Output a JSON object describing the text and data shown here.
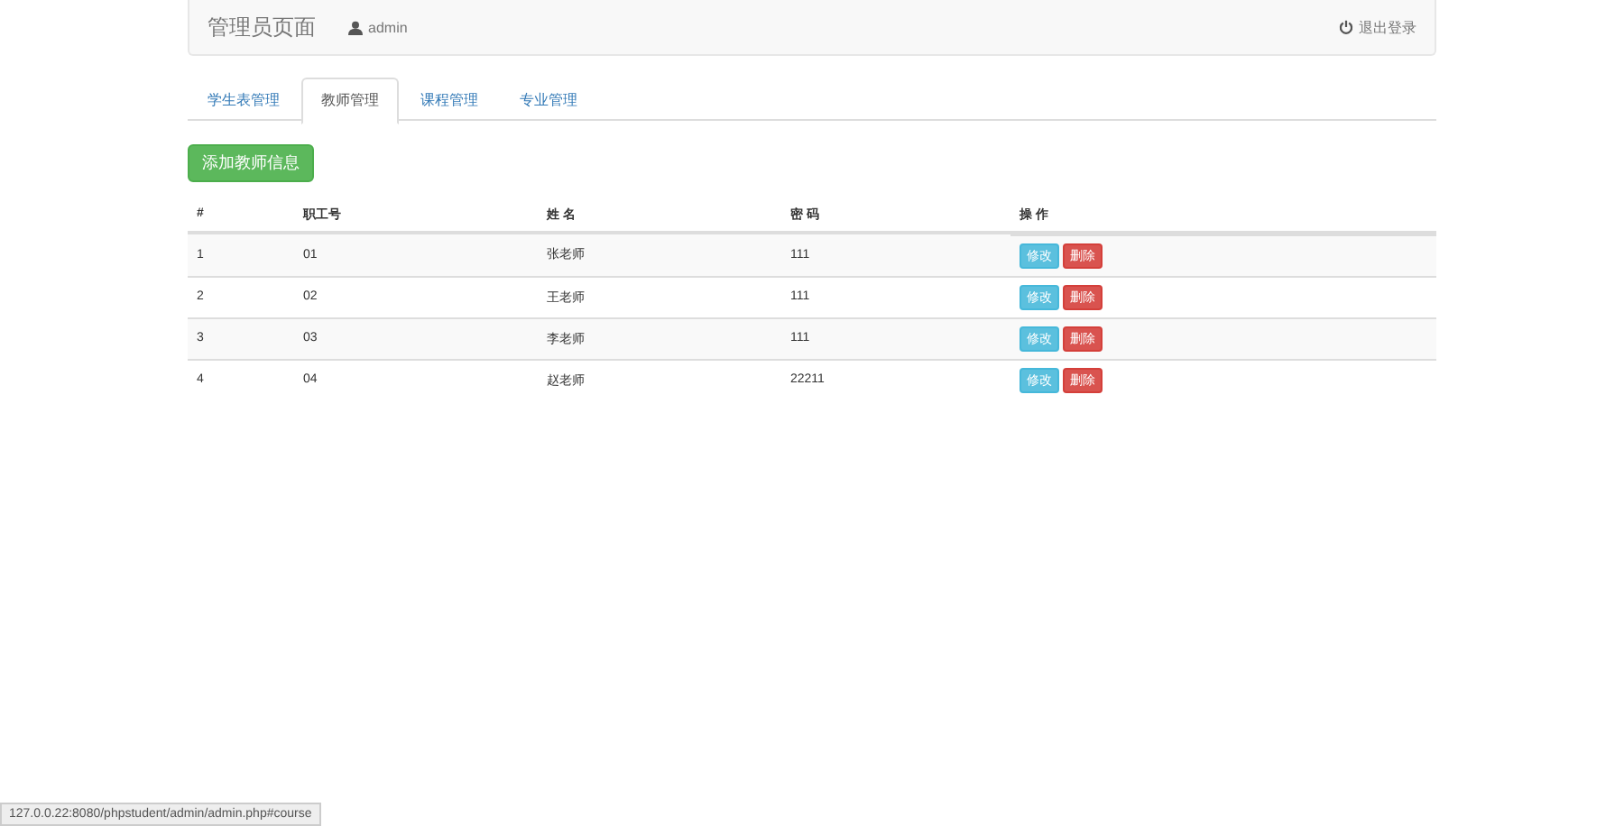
{
  "navbar": {
    "brand": "管理员页面",
    "user": "admin",
    "logout": "退出登录"
  },
  "tabs": [
    {
      "label": "学生表管理",
      "selected": false
    },
    {
      "label": "教师管理",
      "selected": true
    },
    {
      "label": "课程管理",
      "selected": false
    },
    {
      "label": "专业管理",
      "selected": false
    }
  ],
  "add_button": "添加教师信息",
  "table": {
    "columns": [
      "#",
      "职工号",
      "姓 名",
      "密 码",
      "操 作"
    ],
    "rows": [
      {
        "cells": [
          "1",
          "01",
          "张老师",
          "111"
        ],
        "actions": [
          {
            "label": "修改",
            "kind": "edit"
          },
          {
            "label": "删除",
            "kind": "delete"
          }
        ]
      },
      {
        "cells": [
          "2",
          "02",
          "王老师",
          "111"
        ],
        "actions": [
          {
            "label": "修改",
            "kind": "edit"
          },
          {
            "label": "删除",
            "kind": "delete"
          }
        ]
      },
      {
        "cells": [
          "3",
          "03",
          "李老师",
          "111"
        ],
        "actions": [
          {
            "label": "修改",
            "kind": "edit"
          },
          {
            "label": "删除",
            "kind": "delete"
          }
        ]
      },
      {
        "cells": [
          "4",
          "04",
          "赵老师",
          "22211"
        ],
        "actions": [
          {
            "label": "修改",
            "kind": "edit"
          },
          {
            "label": "删除",
            "kind": "delete"
          }
        ]
      }
    ]
  },
  "status_bar": "127.0.0.22:8080/phpstudent/admin/admin.php#course"
}
